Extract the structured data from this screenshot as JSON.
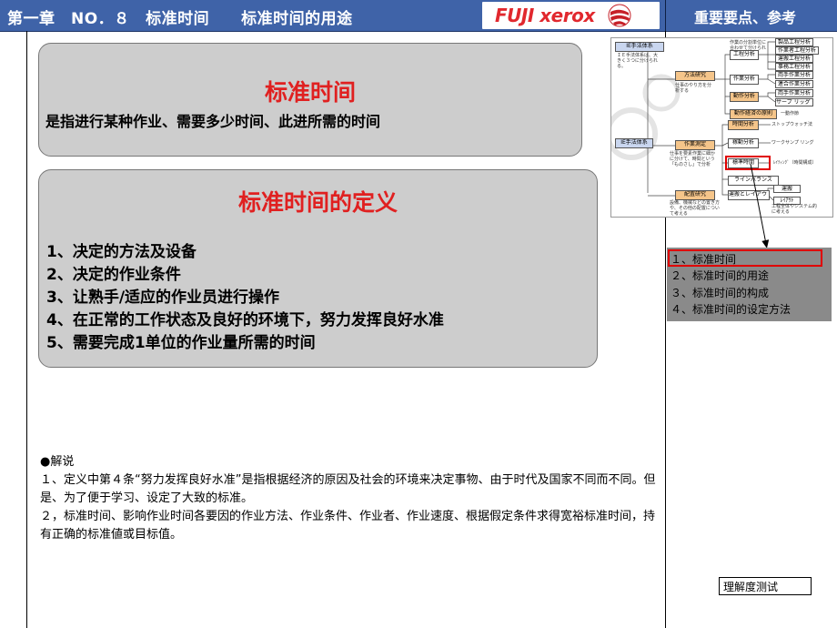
{
  "header": {
    "title": "第一章　NO．８　标准时间　　标准时间的用途",
    "right_title": "重要要点、参考",
    "logo_text": "FUJI xerox",
    "bg_color": "#3f63a8"
  },
  "box1": {
    "title": "标准时间",
    "text": "是指进行某种作业、需要多少时间、此进所需的时间"
  },
  "box2": {
    "title": "标准时间的定义",
    "items": [
      "1、决定的方法及设备",
      "2、决定的作业条件",
      "3、让熟手/适应的作业员进行操作",
      "4、在正常的工作状态及良好的环境下，努力发挥良好水准",
      "5、需要完成1单位的作业量所需的时间"
    ]
  },
  "explain": {
    "heading": "●解说",
    "para1": "１、定义中第４条“努力发挥良好水准”是指根据经济的原因及社会的环境来决定事物、由于时代及国家不同而不同。但是、为了便于学习、设定了大致的标准。",
    "para2": "２，标准时间、影响作业时间各要因的作业方法、作业条件、作业者、作业速度、根据假定条件求得宽裕标准时间，持有正确的标准値或目标值。"
  },
  "diagram": {
    "root1": "IE手法体系",
    "root2": "IE手法体系",
    "note_root": "ＩＥ手法体系は、大きく３つに分けられる。",
    "cat1": "方法研究",
    "cat1_note": "仕事のやり方を分析する",
    "cat2": "作業測定",
    "cat2_note": "仕事を要素作業に細かに分けて、時間という「ものさし」で分析",
    "cat3": "配置研究",
    "cat3_note": "設備、機械などの置き方や、その他の配置について考える",
    "top_note": "作業の分割単位に合わせて分けられる。",
    "sub1": "工程分析",
    "sub2": "作業分析",
    "sub3": "動作分析",
    "sub4": "動作経済の原則",
    "sub5": "時間分析",
    "sub6": "稼動分析",
    "sub7": "標準時間",
    "sub8": "ラインバランス",
    "sub9": "運搬とレイアウト",
    "leaf1": "製品工程分析",
    "leaf2": "作業者工程分析",
    "leaf3": "運搬工程分析",
    "leaf4": "事務工程分析",
    "leaf5": "両手作業分析",
    "leaf6": "連合作業分析",
    "leaf7": "両手作業分析",
    "leaf8": "サーブ リッグ 分析",
    "leaf9": "一動作節",
    "leaf10": "ストップウォッチ法",
    "leaf11": "ワークサンプ リング",
    "leaf12": "ﾚｲﾃｨﾝｸﾞ（時間構成）",
    "leaf13": "運搬",
    "leaf14": "ﾚｲｱｳﾄ",
    "leaf_note": "工程全体やシステム的に考える"
  },
  "toc": {
    "items": [
      "１、标准时间",
      "２、标准时间的用途",
      "３、标准时间的构成",
      "４、标准时间的设定方法"
    ]
  },
  "test_button": "理解度测试",
  "colors": {
    "title_red": "#e02020",
    "box_gray": "#cdcdcd",
    "toc_gray": "#8a8a8a",
    "highlight_red": "#e00000"
  }
}
